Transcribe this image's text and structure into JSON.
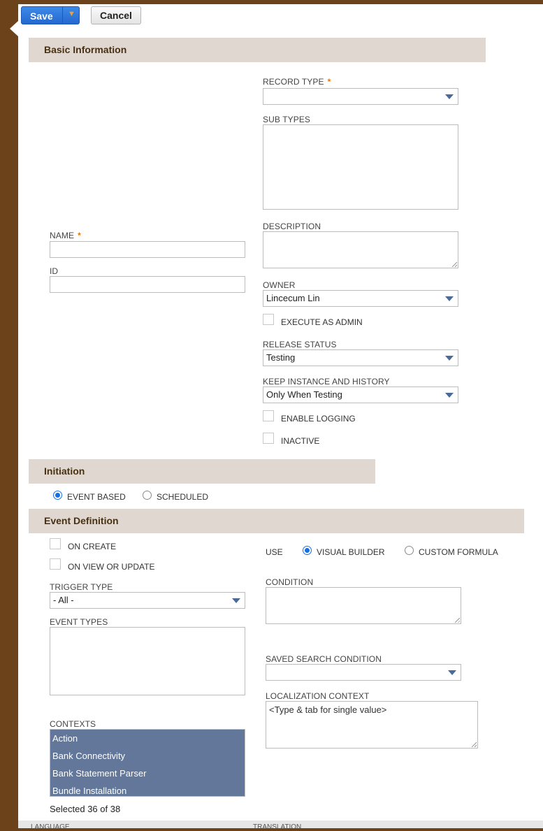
{
  "toolbar": {
    "save_label": "Save",
    "save_dropdown_glyph": "▼",
    "cancel_label": "Cancel"
  },
  "sections": {
    "basic": "Basic Information",
    "initiation": "Initiation",
    "event": "Event Definition"
  },
  "basic": {
    "record_type_label": "RECORD TYPE",
    "record_type_value": "",
    "sub_types_label": "SUB TYPES",
    "name_label": "NAME",
    "name_value": "",
    "id_label": "ID",
    "id_value": "",
    "description_label": "DESCRIPTION",
    "owner_label": "OWNER",
    "owner_value": "Lincecum Lin",
    "execute_as_admin_label": "EXECUTE AS ADMIN",
    "release_status_label": "RELEASE STATUS",
    "release_status_value": "Testing",
    "keep_instance_label": "KEEP INSTANCE AND HISTORY",
    "keep_instance_value": "Only When Testing",
    "enable_logging_label": "ENABLE LOGGING",
    "inactive_label": "INACTIVE",
    "required_marker": "*"
  },
  "initiation": {
    "options": [
      "EVENT BASED",
      "SCHEDULED"
    ],
    "selected": "EVENT BASED"
  },
  "event": {
    "on_create_label": "ON CREATE",
    "on_view_update_label": "ON VIEW OR UPDATE",
    "use_label": "USE",
    "use_options": [
      "VISUAL BUILDER",
      "CUSTOM FORMULA"
    ],
    "use_selected": "VISUAL BUILDER",
    "trigger_type_label": "TRIGGER TYPE",
    "trigger_type_value": "- All -",
    "event_types_label": "EVENT TYPES",
    "condition_label": "CONDITION",
    "saved_search_label": "SAVED SEARCH CONDITION",
    "saved_search_value": "",
    "localization_label": "LOCALIZATION CONTEXT",
    "localization_placeholder": "<Type & tab for single value>",
    "contexts_label": "CONTEXTS",
    "contexts": [
      "Action",
      "Bank Connectivity",
      "Bank Statement Parser",
      "Bundle Installation"
    ],
    "selected_count": "Selected 36 of 38"
  },
  "footer": {
    "col1": "LANGUAGE",
    "col2": "TRANSLATION"
  },
  "colors": {
    "accent": "#2468d0",
    "sidebar": "#6b4219",
    "section_bg": "#e0d8d0",
    "section_text": "#4a3012",
    "list_selected": "#62779a"
  }
}
